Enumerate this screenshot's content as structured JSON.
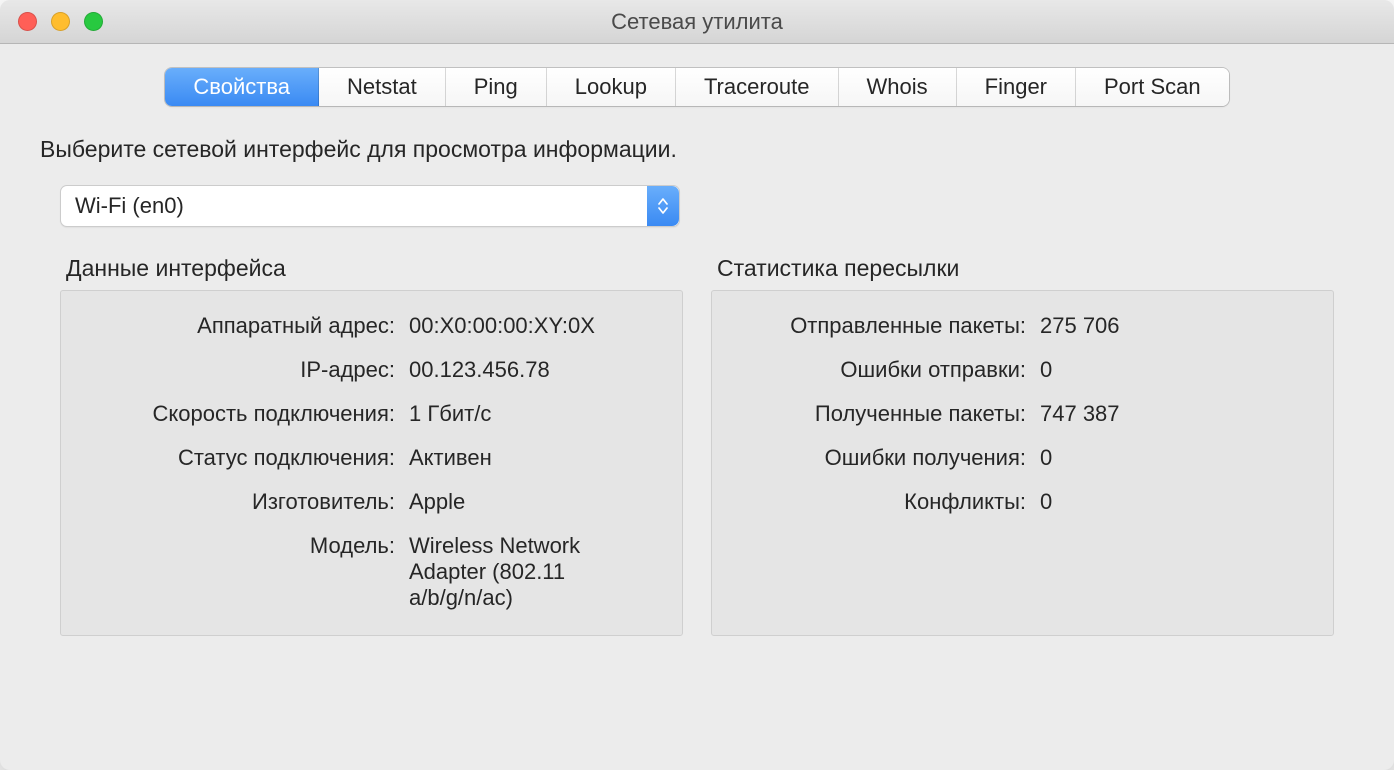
{
  "window": {
    "title": "Сетевая утилита"
  },
  "tabs": [
    {
      "label": "Свойства",
      "active": true
    },
    {
      "label": "Netstat",
      "active": false
    },
    {
      "label": "Ping",
      "active": false
    },
    {
      "label": "Lookup",
      "active": false
    },
    {
      "label": "Traceroute",
      "active": false
    },
    {
      "label": "Whois",
      "active": false
    },
    {
      "label": "Finger",
      "active": false
    },
    {
      "label": "Port Scan",
      "active": false
    }
  ],
  "instruction": "Выберите сетевой интерфейс для просмотра информации.",
  "interface_select": {
    "value": "Wi-Fi (en0)"
  },
  "panels": {
    "interface_info": {
      "title": "Данные интерфейса",
      "fields": {
        "hw_addr_label": "Аппаратный адрес:",
        "hw_addr_value": "00:X0:00:00:XY:0X",
        "ip_label": "IP-адрес:",
        "ip_value": "00.123.456.78",
        "speed_label": "Скорость подключения:",
        "speed_value": "1 Гбит/с",
        "status_label": "Статус подключения:",
        "status_value": "Активен",
        "vendor_label": "Изготовитель:",
        "vendor_value": "Apple",
        "model_label": "Модель:",
        "model_value": "Wireless Network Adapter (802.11 a/b/g/n/ac)"
      }
    },
    "transfer_stats": {
      "title": "Статистика пересылки",
      "fields": {
        "sent_label": "Отправленные пакеты:",
        "sent_value": "275 706",
        "send_err_label": "Ошибки отправки:",
        "send_err_value": "0",
        "recv_label": "Полученные пакеты:",
        "recv_value": "747 387",
        "recv_err_label": "Ошибки получения:",
        "recv_err_value": "0",
        "collisions_label": "Конфликты:",
        "collisions_value": "0"
      }
    }
  }
}
